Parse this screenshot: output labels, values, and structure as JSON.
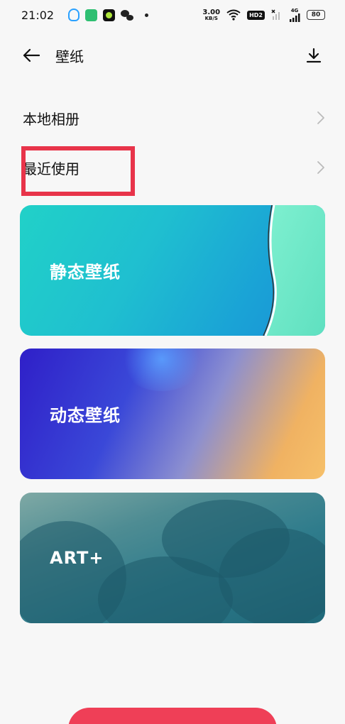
{
  "status_bar": {
    "time": "21:02",
    "network_speed_value": "3.00",
    "network_speed_unit": "KB/S",
    "hd_badge": "HD2",
    "signal_4g": "4G",
    "battery": "80"
  },
  "header": {
    "title": "壁纸"
  },
  "list": {
    "album_label": "本地相册",
    "recent_label": "最近使用"
  },
  "cards": {
    "static_label": "静态壁纸",
    "dynamic_label": "动态壁纸",
    "art_label": "ART+"
  },
  "colors": {
    "highlight_box": "#e8344a",
    "bottom_button": "#ef3f57",
    "background": "#f7f7f7"
  }
}
